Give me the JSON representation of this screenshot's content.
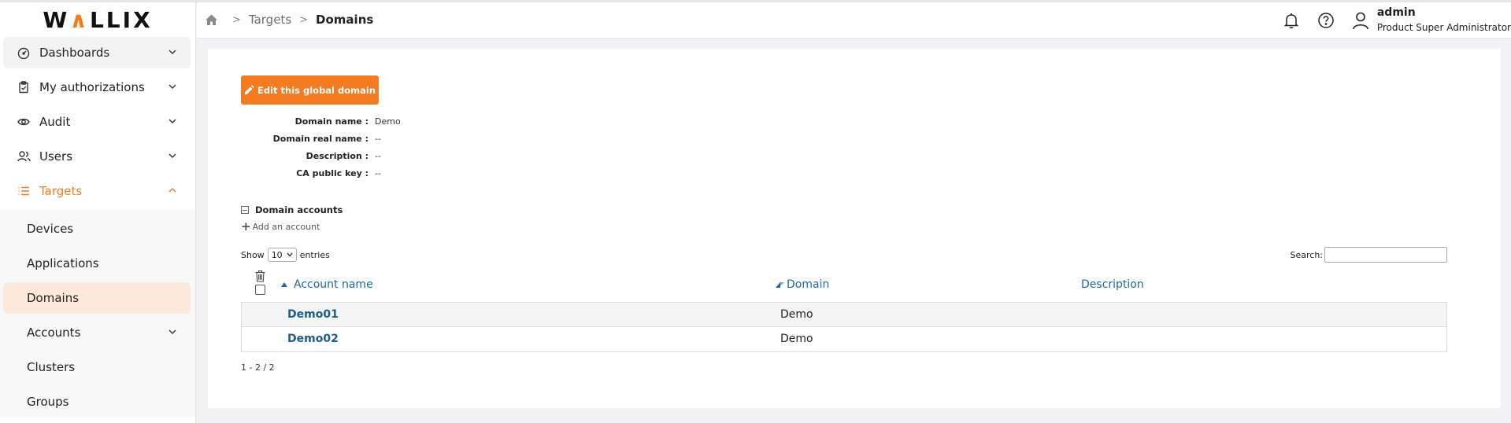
{
  "app": {
    "logo": {
      "pre": "W",
      "accent": "∧",
      "post": "LLIX"
    }
  },
  "sidebar": {
    "items": [
      {
        "label": "Dashboards",
        "icon": "dashboard-icon"
      },
      {
        "label": "My authorizations",
        "icon": "clipboard-check-icon"
      },
      {
        "label": "Audit",
        "icon": "eye-icon"
      },
      {
        "label": "Users",
        "icon": "users-icon"
      },
      {
        "label": "Targets",
        "icon": "list-icon"
      }
    ],
    "subitems": [
      {
        "label": "Devices"
      },
      {
        "label": "Applications"
      },
      {
        "label": "Domains"
      },
      {
        "label": "Accounts"
      },
      {
        "label": "Clusters"
      },
      {
        "label": "Groups"
      }
    ]
  },
  "header": {
    "breadcrumb": {
      "parent": "Targets",
      "current": "Domains"
    },
    "user": {
      "name": "admin",
      "role": "Product Super Administrator"
    }
  },
  "main": {
    "edit_button": "Edit this global domain",
    "properties": [
      {
        "label": "Domain name :",
        "value": "Demo"
      },
      {
        "label": "Domain real name :",
        "value": "--"
      },
      {
        "label": "Description :",
        "value": "--"
      },
      {
        "label": "CA public key :",
        "value": "--"
      }
    ],
    "section_title": "Domain accounts",
    "add_account": "Add an account",
    "show": {
      "prefix": "Show",
      "value": "10",
      "suffix": "entries"
    },
    "search": {
      "label": "Search:",
      "value": ""
    },
    "columns": [
      "Account name",
      "Domain",
      "Description"
    ],
    "rows": [
      {
        "account": "Demo01",
        "domain": "Demo",
        "description": ""
      },
      {
        "account": "Demo02",
        "domain": "Demo",
        "description": ""
      }
    ],
    "pagination": "1 - 2 / 2"
  },
  "colors": {
    "accent": "#f47b20",
    "link": "#1e6aa0",
    "selected_bg": "#fde9dc"
  }
}
